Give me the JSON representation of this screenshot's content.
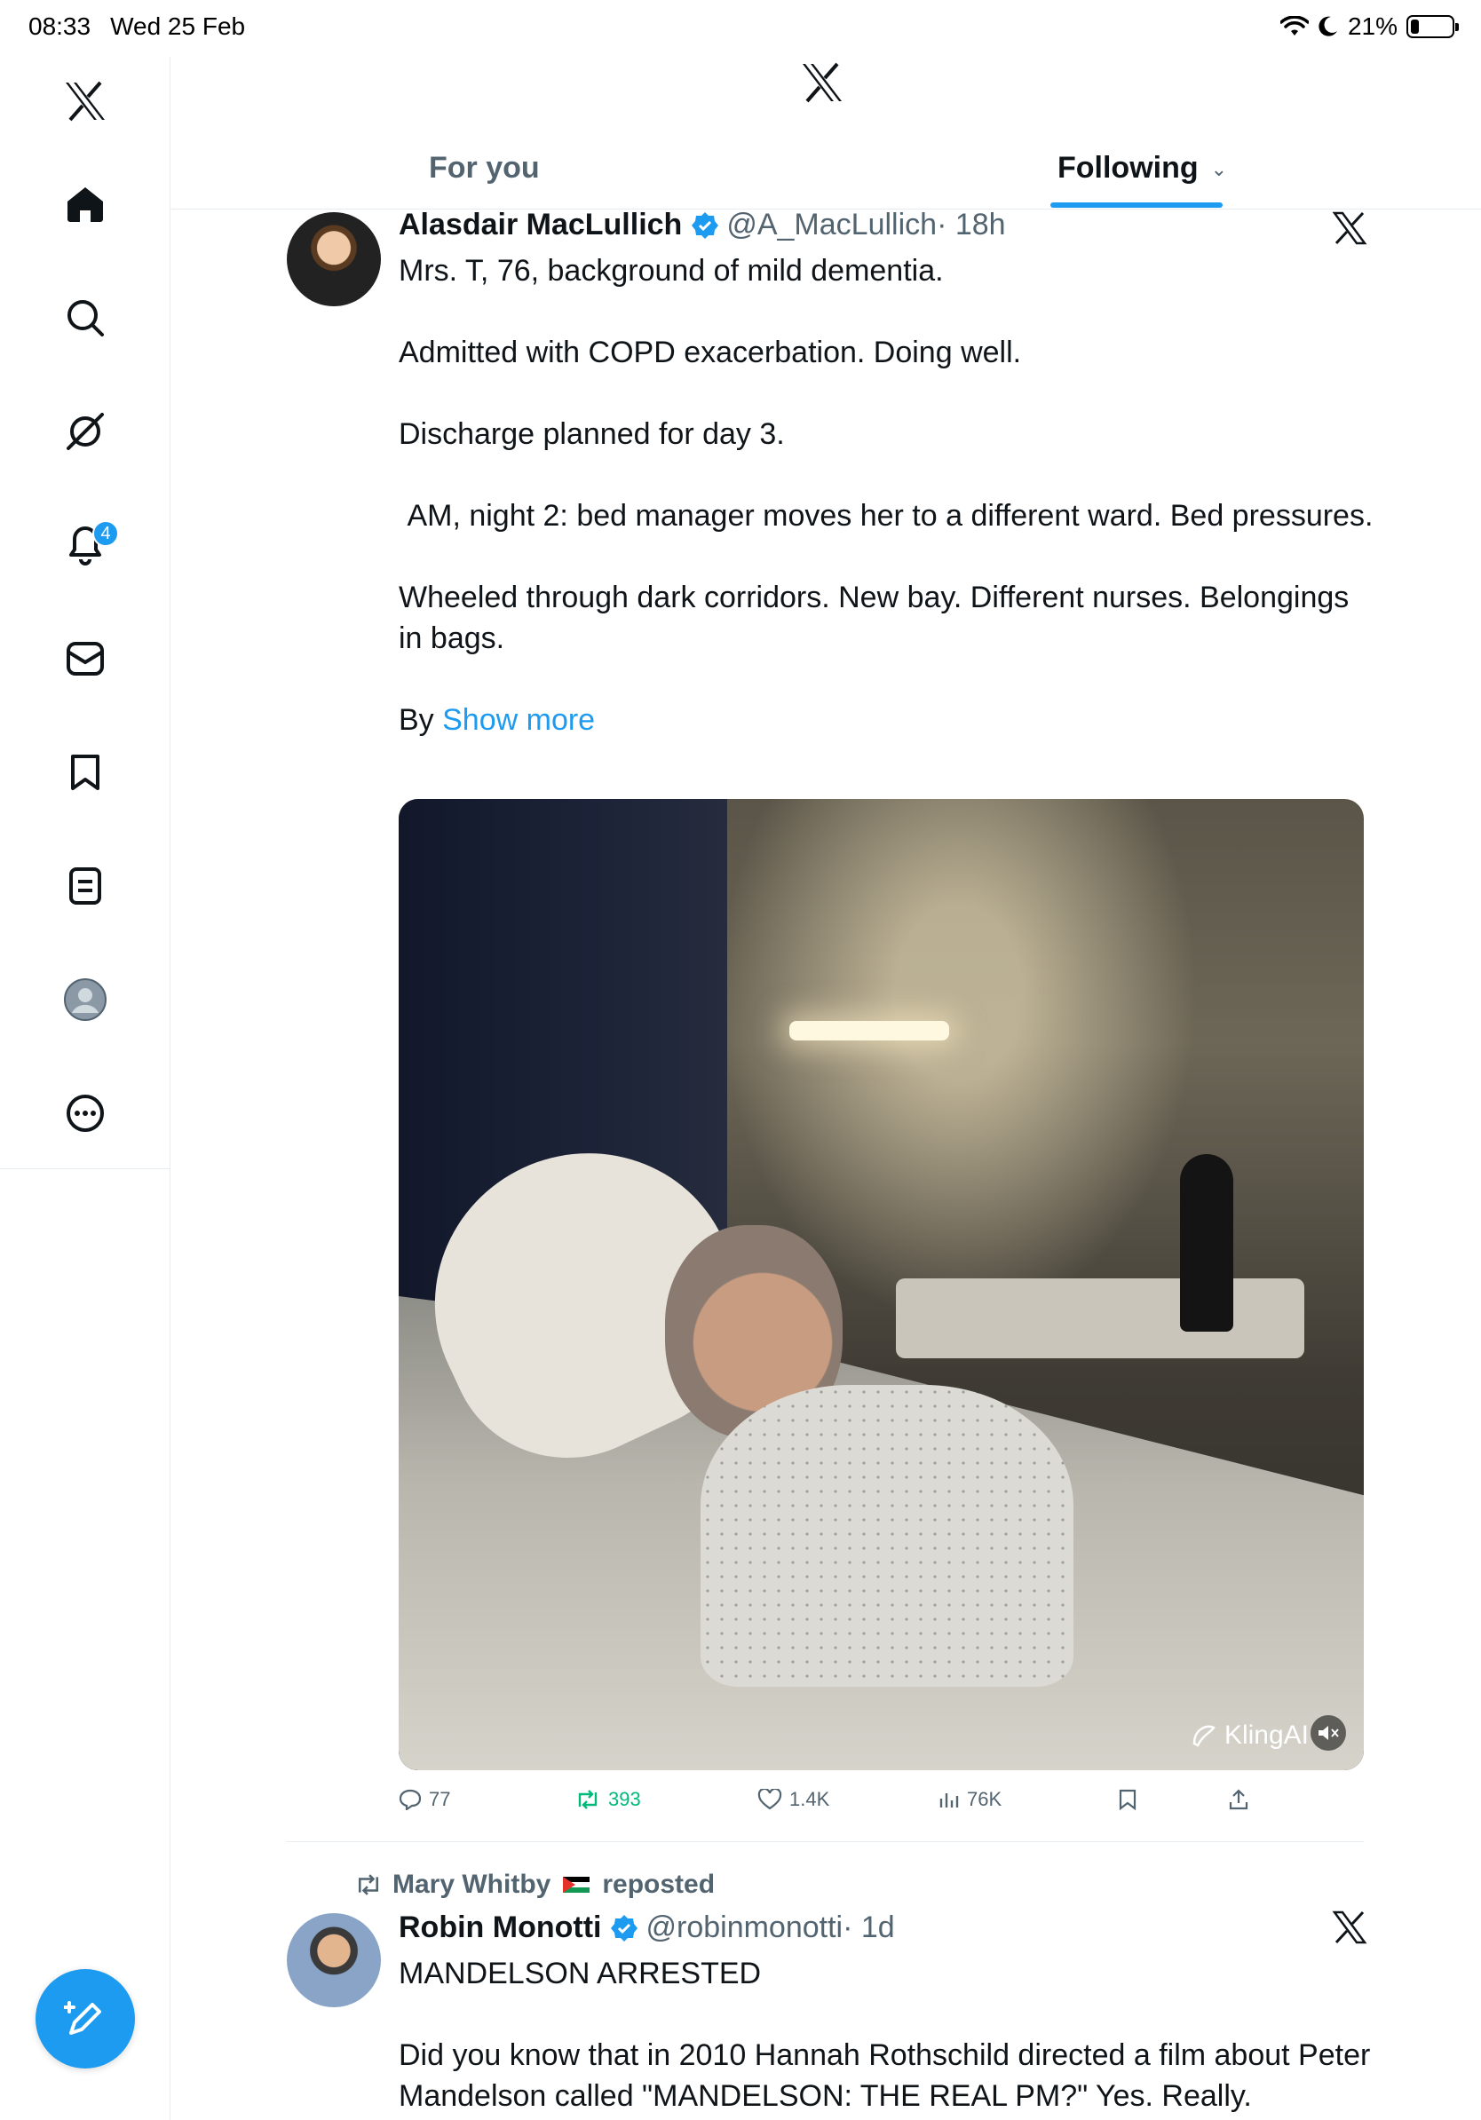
{
  "status_bar": {
    "time": "08:33",
    "date": "Wed 25 Feb",
    "battery": "21%"
  },
  "sidebar": {
    "items": [
      {
        "name": "x-logo"
      },
      {
        "name": "home"
      },
      {
        "name": "explore"
      },
      {
        "name": "grok"
      },
      {
        "name": "notifications",
        "badge": "4"
      },
      {
        "name": "messages"
      },
      {
        "name": "bookmarks"
      },
      {
        "name": "lists"
      },
      {
        "name": "profile"
      },
      {
        "name": "more"
      }
    ]
  },
  "header": {
    "tabs": [
      {
        "label": "For you",
        "active": false
      },
      {
        "label": "Following",
        "active": true
      }
    ]
  },
  "colors": {
    "accent": "#1d9bf0",
    "repost_green": "#00ba7c",
    "secondary_text": "#536471"
  },
  "tweets": [
    {
      "author_name": "Alasdair MacLullich",
      "handle": "@A_MacLullich",
      "time": "· 18h",
      "paragraphs": [
        "Mrs. T, 76, background of mild dementia.",
        "Admitted with COPD exacerbation. Doing well.",
        "Discharge planned for day 3.",
        " AM, night 2: bed manager moves her to a different ward. Bed pressures.",
        "Wheeled through dark corridors. New bay. Different nurses. Belongings in bags."
      ],
      "last_line_prefix": "By ",
      "show_more": "Show more",
      "media_watermark": "KlingAI",
      "stats": {
        "replies": "77",
        "reposts": "393",
        "likes": "1.4K",
        "views": "76K"
      }
    },
    {
      "reposted_by": "Mary Whitby",
      "reposted_label": "reposted",
      "author_name": "Robin Monotti",
      "handle": "@robinmonotti",
      "time": "· 1d",
      "paragraphs": [
        "MANDELSON ARRESTED",
        "Did you know that in 2010 Hannah Rothschild directed a film about Peter Mandelson called \"MANDELSON: THE REAL PM?\" Yes. Really."
      ]
    }
  ]
}
